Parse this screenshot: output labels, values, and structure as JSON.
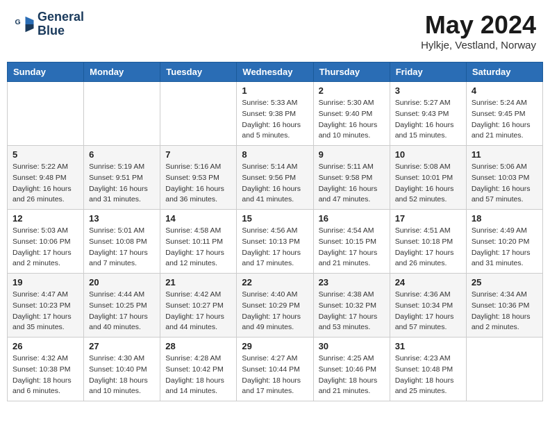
{
  "header": {
    "logo_line1": "General",
    "logo_line2": "Blue",
    "month_title": "May 2024",
    "location": "Hylkje, Vestland, Norway"
  },
  "days_of_week": [
    "Sunday",
    "Monday",
    "Tuesday",
    "Wednesday",
    "Thursday",
    "Friday",
    "Saturday"
  ],
  "weeks": [
    [
      {
        "day": "",
        "info": ""
      },
      {
        "day": "",
        "info": ""
      },
      {
        "day": "",
        "info": ""
      },
      {
        "day": "1",
        "info": "Sunrise: 5:33 AM\nSunset: 9:38 PM\nDaylight: 16 hours\nand 5 minutes."
      },
      {
        "day": "2",
        "info": "Sunrise: 5:30 AM\nSunset: 9:40 PM\nDaylight: 16 hours\nand 10 minutes."
      },
      {
        "day": "3",
        "info": "Sunrise: 5:27 AM\nSunset: 9:43 PM\nDaylight: 16 hours\nand 15 minutes."
      },
      {
        "day": "4",
        "info": "Sunrise: 5:24 AM\nSunset: 9:45 PM\nDaylight: 16 hours\nand 21 minutes."
      }
    ],
    [
      {
        "day": "5",
        "info": "Sunrise: 5:22 AM\nSunset: 9:48 PM\nDaylight: 16 hours\nand 26 minutes."
      },
      {
        "day": "6",
        "info": "Sunrise: 5:19 AM\nSunset: 9:51 PM\nDaylight: 16 hours\nand 31 minutes."
      },
      {
        "day": "7",
        "info": "Sunrise: 5:16 AM\nSunset: 9:53 PM\nDaylight: 16 hours\nand 36 minutes."
      },
      {
        "day": "8",
        "info": "Sunrise: 5:14 AM\nSunset: 9:56 PM\nDaylight: 16 hours\nand 41 minutes."
      },
      {
        "day": "9",
        "info": "Sunrise: 5:11 AM\nSunset: 9:58 PM\nDaylight: 16 hours\nand 47 minutes."
      },
      {
        "day": "10",
        "info": "Sunrise: 5:08 AM\nSunset: 10:01 PM\nDaylight: 16 hours\nand 52 minutes."
      },
      {
        "day": "11",
        "info": "Sunrise: 5:06 AM\nSunset: 10:03 PM\nDaylight: 16 hours\nand 57 minutes."
      }
    ],
    [
      {
        "day": "12",
        "info": "Sunrise: 5:03 AM\nSunset: 10:06 PM\nDaylight: 17 hours\nand 2 minutes."
      },
      {
        "day": "13",
        "info": "Sunrise: 5:01 AM\nSunset: 10:08 PM\nDaylight: 17 hours\nand 7 minutes."
      },
      {
        "day": "14",
        "info": "Sunrise: 4:58 AM\nSunset: 10:11 PM\nDaylight: 17 hours\nand 12 minutes."
      },
      {
        "day": "15",
        "info": "Sunrise: 4:56 AM\nSunset: 10:13 PM\nDaylight: 17 hours\nand 17 minutes."
      },
      {
        "day": "16",
        "info": "Sunrise: 4:54 AM\nSunset: 10:15 PM\nDaylight: 17 hours\nand 21 minutes."
      },
      {
        "day": "17",
        "info": "Sunrise: 4:51 AM\nSunset: 10:18 PM\nDaylight: 17 hours\nand 26 minutes."
      },
      {
        "day": "18",
        "info": "Sunrise: 4:49 AM\nSunset: 10:20 PM\nDaylight: 17 hours\nand 31 minutes."
      }
    ],
    [
      {
        "day": "19",
        "info": "Sunrise: 4:47 AM\nSunset: 10:23 PM\nDaylight: 17 hours\nand 35 minutes."
      },
      {
        "day": "20",
        "info": "Sunrise: 4:44 AM\nSunset: 10:25 PM\nDaylight: 17 hours\nand 40 minutes."
      },
      {
        "day": "21",
        "info": "Sunrise: 4:42 AM\nSunset: 10:27 PM\nDaylight: 17 hours\nand 44 minutes."
      },
      {
        "day": "22",
        "info": "Sunrise: 4:40 AM\nSunset: 10:29 PM\nDaylight: 17 hours\nand 49 minutes."
      },
      {
        "day": "23",
        "info": "Sunrise: 4:38 AM\nSunset: 10:32 PM\nDaylight: 17 hours\nand 53 minutes."
      },
      {
        "day": "24",
        "info": "Sunrise: 4:36 AM\nSunset: 10:34 PM\nDaylight: 17 hours\nand 57 minutes."
      },
      {
        "day": "25",
        "info": "Sunrise: 4:34 AM\nSunset: 10:36 PM\nDaylight: 18 hours\nand 2 minutes."
      }
    ],
    [
      {
        "day": "26",
        "info": "Sunrise: 4:32 AM\nSunset: 10:38 PM\nDaylight: 18 hours\nand 6 minutes."
      },
      {
        "day": "27",
        "info": "Sunrise: 4:30 AM\nSunset: 10:40 PM\nDaylight: 18 hours\nand 10 minutes."
      },
      {
        "day": "28",
        "info": "Sunrise: 4:28 AM\nSunset: 10:42 PM\nDaylight: 18 hours\nand 14 minutes."
      },
      {
        "day": "29",
        "info": "Sunrise: 4:27 AM\nSunset: 10:44 PM\nDaylight: 18 hours\nand 17 minutes."
      },
      {
        "day": "30",
        "info": "Sunrise: 4:25 AM\nSunset: 10:46 PM\nDaylight: 18 hours\nand 21 minutes."
      },
      {
        "day": "31",
        "info": "Sunrise: 4:23 AM\nSunset: 10:48 PM\nDaylight: 18 hours\nand 25 minutes."
      },
      {
        "day": "",
        "info": ""
      }
    ]
  ]
}
